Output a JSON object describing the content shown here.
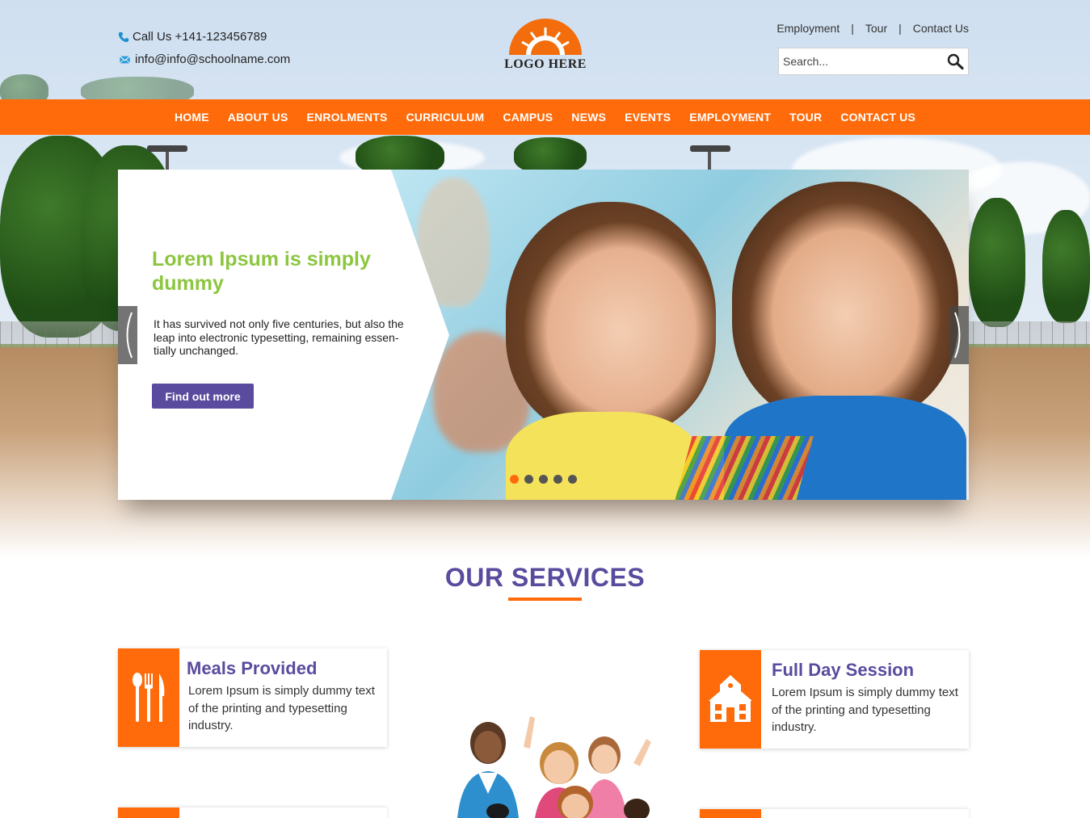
{
  "header": {
    "phone_text": "Call Us +141-123456789",
    "email_text": "info@info@schoolname.com",
    "logo_text": "LOGO HERE",
    "top_links": [
      "Employment",
      "Tour",
      "Contact Us"
    ],
    "separator": "|",
    "search_placeholder": "Search..."
  },
  "nav": {
    "items": [
      "HOME",
      "ABOUT US",
      "ENROLMENTS",
      "CURRICULUM",
      "CAMPUS",
      "NEWS",
      "EVENTS",
      "EMPLOYMENT",
      "TOUR",
      "CONTACT US"
    ]
  },
  "slider": {
    "title": "Lorem Ipsum is simply dummy",
    "text": "It has survived not only five centuries, but also the leap into electronic typesetting, remaining essen-tially unchanged.",
    "button_label": "Find out more",
    "slide_count": 5,
    "active_slide": 1
  },
  "services": {
    "title": "OUR SERVICES",
    "cards": [
      {
        "title": "Meals Provided",
        "text": "Lorem Ipsum is simply dummy text of the printing and typesetting industry.",
        "icon": "cutlery-icon"
      },
      {
        "title": "Full Day Session",
        "text": "Lorem Ipsum is simply dummy text of the printing and typesetting industry.",
        "icon": "schoolhouse-icon"
      }
    ]
  },
  "colors": {
    "accent_orange": "#ff6b0a",
    "brand_purple": "#5a4b9e",
    "headline_green": "#8cc63f"
  }
}
